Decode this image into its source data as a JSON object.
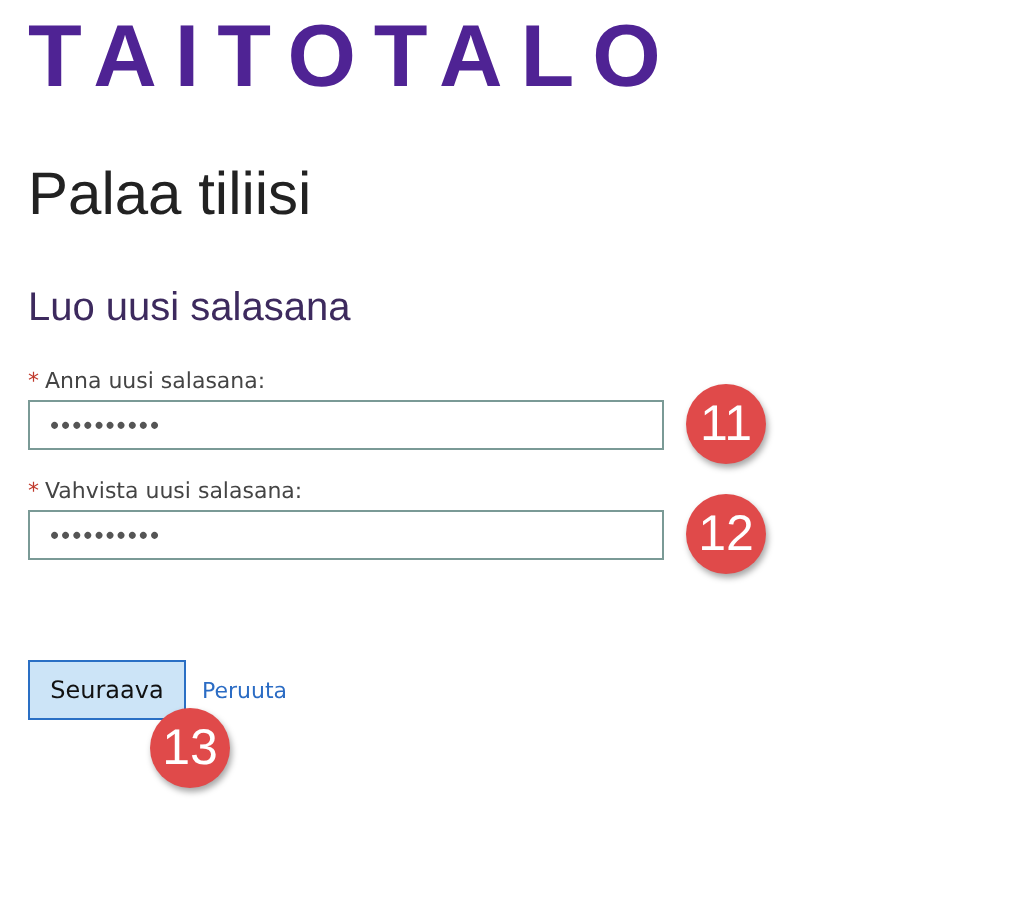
{
  "logo": "TAITOTALO",
  "title": "Palaa tiliisi",
  "subtitle": "Luo uusi salasana",
  "fields": [
    {
      "required_mark": "*",
      "label": "Anna uusi salasana:",
      "value": "••••••••••",
      "callout": "11"
    },
    {
      "required_mark": "*",
      "label": "Vahvista uusi salasana:",
      "value": "••••••••••",
      "callout": "12"
    }
  ],
  "buttons": [
    {
      "kind": "primary",
      "label": "Seuraava",
      "callout": "13"
    },
    {
      "kind": "link",
      "label": "Peruuta"
    }
  ]
}
